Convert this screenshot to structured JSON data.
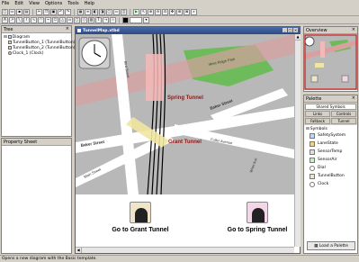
{
  "menu": [
    "File",
    "Edit",
    "View",
    "Options",
    "Tools",
    "Help"
  ],
  "tree": {
    "title": "Tree",
    "items": [
      "Diagram",
      "TunnelButton_1 (TunnelButton)",
      "TunnelButton_2 (TunnelButton)",
      "Clock_1 (Clock)"
    ]
  },
  "property_sheet": {
    "title": "Property Sheet"
  },
  "document": {
    "title": "TunnelMap.xtbd"
  },
  "map": {
    "labels": {
      "west_ridge_park": "West Ridge Park",
      "spring_tunnel": "Spring Tunnel",
      "grant_tunnel": "Grant Tunnel",
      "baker_street_1": "Baker Street",
      "baker_street_2": "Baker Street",
      "fuller_avenue": "Fuller Avenue",
      "main_street": "Main Street",
      "bird_street": "Bird Street",
      "wnet_ave": "Wnet Ave"
    }
  },
  "buttons": {
    "grant": "Go to Grant Tunnel",
    "spring": "Go to Spring Tunnel"
  },
  "overview": {
    "title": "Overview"
  },
  "palette": {
    "title": "Palette",
    "tabs": [
      "Shared Symbols",
      "Links",
      "Controls",
      "Fallback",
      "Tunnel"
    ],
    "section": "Symbols",
    "items": [
      "SafetySystem",
      "LaneState",
      "SensorTemp",
      "SensorAir",
      "Dial",
      "TunnelButton",
      "Clock"
    ],
    "load_button": "Load a Palette"
  },
  "status": "Opens a new diagram with the Basic template.",
  "colors": {
    "spring_highlight": "#f5b8b8",
    "grant_highlight": "#f0e6a0",
    "park": "#6dbb5a",
    "road_band": "#d9a0a0",
    "tunnel_label": "#8b1a1a"
  }
}
